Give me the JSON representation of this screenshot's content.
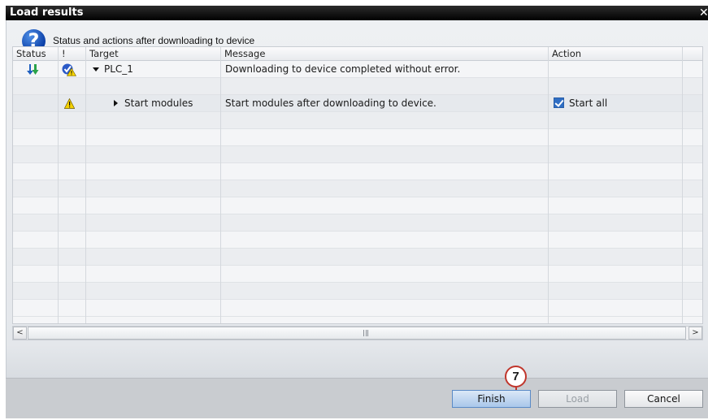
{
  "dialog": {
    "title": "Load results",
    "close_glyph": "✕",
    "header_icon": "question-icon",
    "header_icon_glyph": "?",
    "header_text": "Status and actions after downloading to device"
  },
  "grid": {
    "columns": [
      {
        "key": "status",
        "label": "Status"
      },
      {
        "key": "excl",
        "label": "!"
      },
      {
        "key": "target",
        "label": "Target"
      },
      {
        "key": "message",
        "label": "Message"
      },
      {
        "key": "action",
        "label": "Action"
      }
    ],
    "rows": [
      {
        "status_icon": "download-icon",
        "excl_icon": "checkmark-warning-icon",
        "target": "PLC_1",
        "expander": "expanded",
        "message": "Downloading to device completed without error.",
        "action": ""
      },
      {
        "status_icon": "",
        "excl_icon": "",
        "target": "",
        "expander": "",
        "message": "",
        "action": ""
      },
      {
        "status_icon": "",
        "excl_icon": "warning-icon",
        "target": "Start modules",
        "expander": "collapsed",
        "message": "Start modules after downloading to device.",
        "action": "Start all",
        "action_checked": true
      }
    ]
  },
  "scrollbar": {
    "left_arrow": "<",
    "right_arrow": ">"
  },
  "buttons": {
    "finish": "Finish",
    "load": "Load",
    "cancel": "Cancel"
  },
  "callout": {
    "label": "7"
  },
  "colors": {
    "title_bar": "#000000",
    "accent_blue": "#2f6ec4",
    "warning_yellow": "#f5d200",
    "callout_red": "#c0362c"
  }
}
